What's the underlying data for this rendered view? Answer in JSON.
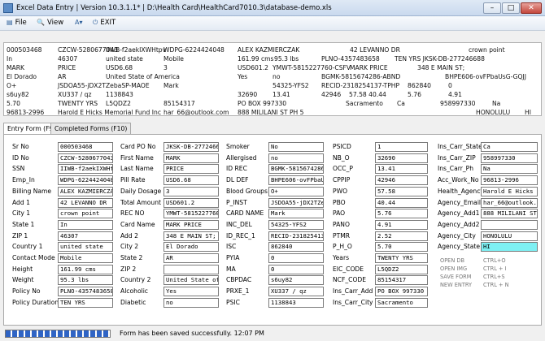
{
  "window": {
    "title": "Excel Data Entry | Version 10.3.1.1* | D:\\Health Card\\HealthCard7010.3\\database-demo.xls",
    "min": "–",
    "max": "□",
    "close": "✕"
  },
  "menu": [
    {
      "label": "File",
      "icon": "file-icon",
      "glyph": "▤"
    },
    {
      "label": "View",
      "icon": "view-icon",
      "glyph": "🔍"
    },
    {
      "label": "",
      "icon": "font-icon",
      "glyph": "A▾"
    },
    {
      "label": "EXIT",
      "icon": "exit-icon",
      "glyph": "⏻"
    }
  ],
  "grid": {
    "rows": [
      [
        "000503468",
        "CZCW-5280677043",
        "IIWB-f2aekIXWHtpv",
        "WDPG-6224424048",
        "ALEX KAZMIERCZAK",
        "",
        "42 LEVANNO DR",
        "",
        "crown point"
      ],
      [
        "In",
        "46307",
        "united state",
        "Mobile",
        "161.99 cms",
        "95.3 lbs",
        "PLNO-4357483658",
        "",
        "TEN YRS  JKSK-DB-277246688"
      ],
      [
        "MARK",
        "PRICE",
        "USD6.68",
        "3",
        "USD601.2",
        "YMWT-5815227760-CSFV",
        "MARK PRICE",
        "",
        "348 E MAIN ST;"
      ],
      [
        "El Dorado",
        "AR",
        "United State of America",
        "Yes",
        "no",
        "BGMK-5815674286-ABND",
        "",
        "",
        "BHPE606-ovFPbaUsG-GQJJ"
      ],
      [
        "O+",
        "JSDOA55-jDX2TZebaSP-MAOE",
        "",
        "Mark",
        "",
        "54325-YFS2",
        "RECID-2318254137-TPHP",
        "862840",
        "0"
      ],
      [
        "s6uy82",
        "XU337 / qz",
        "1138843",
        "",
        "32690",
        "13.41",
        "42946",
        "57.58  40.44",
        "5.76",
        "4.91"
      ],
      [
        "5.70",
        "TWENTY YRS",
        "L5QDZ2",
        "",
        "85154317",
        "",
        "PO BOX 997330",
        "",
        "Sacramento",
        "Ca",
        "958997330",
        "Na"
      ],
      [
        "96813-2996",
        "Harold E Hicks Memorial Fund Inc",
        "",
        "",
        "har_66@outlook.com",
        "",
        "888 MILILANI ST PH 5",
        "",
        "",
        "",
        "HONOLULU",
        "HI"
      ]
    ]
  },
  "tabs": [
    {
      "label": "Entry Form (F9)"
    },
    {
      "label": "Completed Forms (F10)"
    }
  ],
  "form": {
    "col1": [
      {
        "label": "Sr No",
        "value": "000503468"
      },
      {
        "label": "ID No",
        "value": "CZCW-5280677043"
      },
      {
        "label": "SSN",
        "value": "IIWB-f2aekIXWHtpv"
      },
      {
        "label": "Emp_In",
        "value": "WDPG-6224424048"
      },
      {
        "label": "Billing Name",
        "value": "ALEX KAZMIERCZAK"
      },
      {
        "label": "Add 1",
        "value": "42 LEVANNO DR"
      },
      {
        "label": "City 1",
        "value": "crown point"
      },
      {
        "label": "State 1",
        "value": "In"
      },
      {
        "label": "ZIP 1",
        "value": "46307"
      },
      {
        "label": "Country 1",
        "value": "united state"
      },
      {
        "label": "Contact Mode",
        "value": "Mobile"
      },
      {
        "label": "Height",
        "value": "161.99 cms"
      },
      {
        "label": "Weight",
        "value": "95.3 lbs"
      },
      {
        "label": "Policy No",
        "value": "PLNO-4357483658"
      },
      {
        "label": "Policy Duration",
        "value": "TEN YRS"
      }
    ],
    "col2": [
      {
        "label": "Card PO No",
        "value": "JKSK-DB-277246688"
      },
      {
        "label": "First Name",
        "value": "MARK"
      },
      {
        "label": "Last Name",
        "value": "PRICE"
      },
      {
        "label": "Pill Rate",
        "value": "USD6.68"
      },
      {
        "label": "Daily Dosage",
        "value": "3"
      },
      {
        "label": "Total Amount",
        "value": "USD601.2"
      },
      {
        "label": "REC NO",
        "value": "YMWT-5815227760-CSFV"
      },
      {
        "label": "Card Name",
        "value": "MARK PRICE"
      },
      {
        "label": "Add 2",
        "value": "348 E MAIN ST;"
      },
      {
        "label": "City 2",
        "value": "El Dorado"
      },
      {
        "label": "State 2",
        "value": "AR"
      },
      {
        "label": "ZIP 2",
        "value": ""
      },
      {
        "label": "Country 2",
        "value": "United State of America"
      },
      {
        "label": "Alcoholic",
        "value": "Yes"
      },
      {
        "label": "Diabetic",
        "value": "no"
      }
    ],
    "col3": [
      {
        "label": "Smoker",
        "value": "No"
      },
      {
        "label": "Allergised",
        "value": "no"
      },
      {
        "label": "ID REC",
        "value": "BGMK-5815674286-ABND"
      },
      {
        "label": "DL DEF",
        "value": "BHPE606-ovFPbaUsG-GQJJ"
      },
      {
        "label": "Blood Groups",
        "value": "O+"
      },
      {
        "label": "P_INST",
        "value": "JSDOA55-jDX2TZebaSP-MAOE"
      },
      {
        "label": "CARD NAME",
        "value": "Mark"
      },
      {
        "label": "INC_DEL",
        "value": "54325-YFS2"
      },
      {
        "label": "ID_REC_1",
        "value": "RECID-2318254137-TPHP"
      },
      {
        "label": "ISC",
        "value": "862840"
      },
      {
        "label": "PYIA",
        "value": "0"
      },
      {
        "label": "MA",
        "value": "0"
      },
      {
        "label": "CBPDAC",
        "value": "s6uy82"
      },
      {
        "label": "PRXE_1",
        "value": "XU337 / qz"
      },
      {
        "label": "PSIC",
        "value": "1138843"
      }
    ],
    "col4": [
      {
        "label": "PSICD",
        "value": "1"
      },
      {
        "label": "NB_O",
        "value": "32690"
      },
      {
        "label": "OCC_P",
        "value": "13.41"
      },
      {
        "label": "CPPIP",
        "value": "42946"
      },
      {
        "label": "PWO",
        "value": "57.58"
      },
      {
        "label": "PBO",
        "value": "40.44"
      },
      {
        "label": "PAO",
        "value": "5.76"
      },
      {
        "label": "PANO",
        "value": "4.91"
      },
      {
        "label": "PTMR",
        "value": "2.52"
      },
      {
        "label": "P_H_O",
        "value": "5.70"
      },
      {
        "label": "Years",
        "value": "TWENTY YRS"
      },
      {
        "label": "EIC_CODE",
        "value": "L5QDZ2"
      },
      {
        "label": "NCF_CODE",
        "value": "85154317"
      },
      {
        "label": "Ins_Carr_Add",
        "value": "PO BOX 997330"
      },
      {
        "label": "Ins_Carr_City",
        "value": "Sacramento"
      }
    ],
    "col5": [
      {
        "label": "Ins_Carr_State",
        "value": "Ca"
      },
      {
        "label": "Ins_Carr_ZIP",
        "value": "958997330"
      },
      {
        "label": "Ins_Carr_Ph",
        "value": "Na"
      },
      {
        "label": "Acc_Work_No",
        "value": "96813-2996"
      },
      {
        "label": "Health_Agency",
        "value": "Harold E Hicks"
      },
      {
        "label": "Agency_Email",
        "value": "har_66@outlook.com"
      },
      {
        "label": "Agency_Add1",
        "value": "888 MILILANI ST"
      },
      {
        "label": "Agency_Add2",
        "value": ""
      },
      {
        "label": "Agency_City",
        "value": "HONOLULU"
      },
      {
        "label": "Agency_State",
        "value": "HI"
      }
    ],
    "commands": [
      {
        "label": "OPEN DB",
        "key": "CTRL+O"
      },
      {
        "label": "OPEN IMG",
        "key": "CTRL + I"
      },
      {
        "label": "SAVE FORM",
        "key": "CTRL+S"
      },
      {
        "label": "NEW ENTRY",
        "key": "CTRL + N"
      }
    ]
  },
  "status": {
    "progress": 1.0,
    "message": "Form has been saved successfully. 12:07 PM"
  },
  "colors": {
    "highlight": "#7ef0f3",
    "progress": "#2f64c5"
  }
}
